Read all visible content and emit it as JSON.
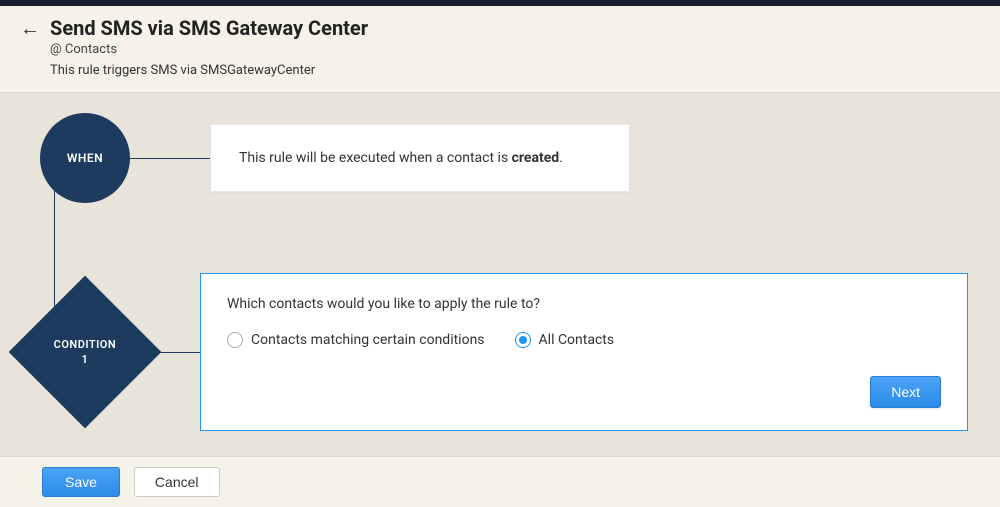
{
  "header": {
    "title": "Send SMS via SMS Gateway Center",
    "context_prefix": "@",
    "context_module": "Contacts",
    "description": "This rule triggers SMS via SMSGatewayCenter"
  },
  "flow": {
    "when": {
      "label": "WHEN",
      "text_prefix": "This rule will be executed when a contact is ",
      "text_bold": "created",
      "text_suffix": "."
    },
    "condition": {
      "label_line1": "CONDITION",
      "label_line2": "1",
      "question": "Which contacts would you like to apply the rule to?",
      "option1": "Contacts matching certain conditions",
      "option2": "All Contacts",
      "selected": "option2",
      "next_label": "Next"
    }
  },
  "footer": {
    "save_label": "Save",
    "cancel_label": "Cancel"
  }
}
